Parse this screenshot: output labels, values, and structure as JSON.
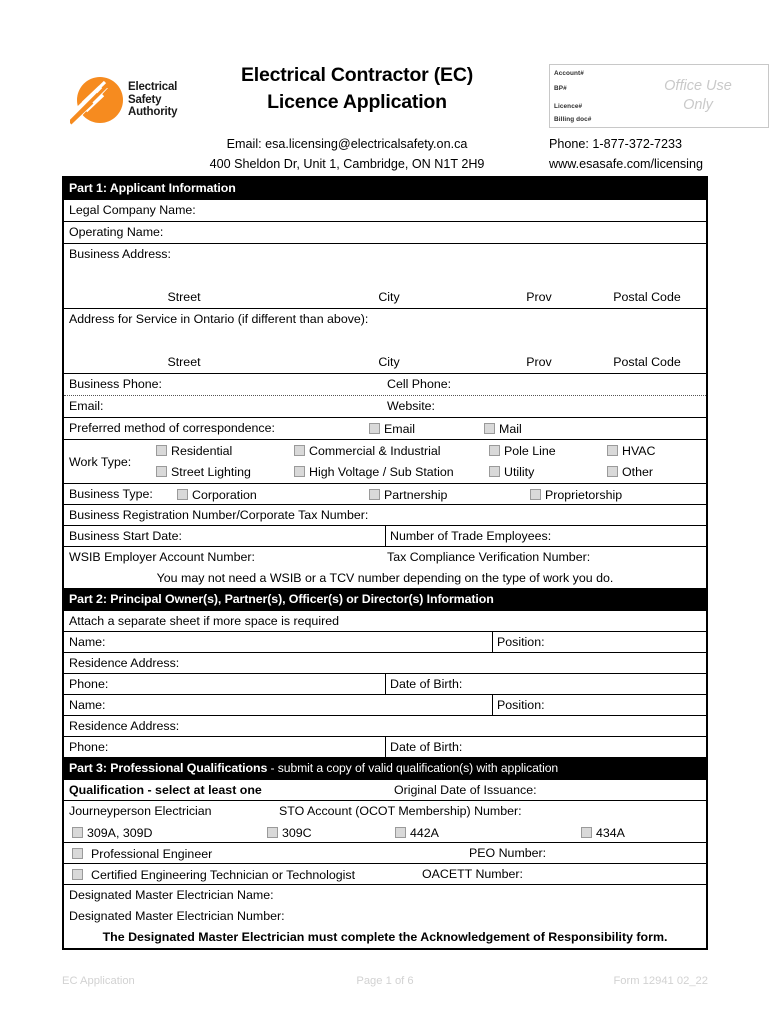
{
  "header": {
    "logo_words": [
      "Electrical",
      "Safety",
      "Authority"
    ],
    "logo_color": "#F68B1F",
    "title_line1": "Electrical Contractor (EC)",
    "title_line2": "Licence Application",
    "email_line": "Email: esa.licensing@electricalsafety.on.ca",
    "address_line": "400 Sheldon Dr, Unit 1, Cambridge, ON N1T 2H9",
    "phone_line": "Phone: 1-877-372-7233",
    "website_line": "www.esasafe.com/licensing",
    "office_use": {
      "watermark_line1": "Office Use",
      "watermark_line2": "Only",
      "fields": [
        "Account#",
        "BP#",
        "Licence#",
        "Billing doc#"
      ]
    }
  },
  "part1": {
    "header": "Part 1: Applicant Information",
    "legal_company_name": "Legal Company Name:",
    "operating_name": "Operating Name:",
    "business_address": "Business Address:",
    "service_address": "Address for Service in Ontario (if different than above):",
    "address_columns": [
      "Street",
      "City",
      "Prov",
      "Postal Code"
    ],
    "business_phone": "Business Phone:",
    "cell_phone": "Cell Phone:",
    "email": "Email:",
    "website": "Website:",
    "preferred_method": "Preferred method of correspondence:",
    "preferred_options": [
      "Email",
      "Mail"
    ],
    "work_type_label": "Work Type:",
    "work_type_options_row1": [
      "Residential",
      "Commercial & Industrial",
      "Pole Line",
      "HVAC"
    ],
    "work_type_options_row2": [
      "Street Lighting",
      "High Voltage / Sub Station",
      "Utility",
      "Other"
    ],
    "business_type_label": "Business Type:",
    "business_type_options": [
      "Corporation",
      "Partnership",
      "Proprietorship"
    ],
    "business_registration": "Business Registration Number/Corporate Tax Number:",
    "business_start_date": "Business Start Date:",
    "trade_employees": "Number of Trade Employees:",
    "wsib": "WSIB Employer Account Number:",
    "tcv": "Tax Compliance Verification Number:",
    "wsib_note": "You may not need a WSIB or a TCV number depending on the type of work you do."
  },
  "part2": {
    "header": "Part 2: Principal Owner(s), Partner(s), Officer(s) or Director(s) Information",
    "attach_note": "Attach a separate sheet if more space is required",
    "name": "Name:",
    "position": "Position:",
    "residence_address": "Residence Address:",
    "phone": "Phone:",
    "date_of_birth": "Date of Birth:"
  },
  "part3": {
    "header_bold": "Part 3: Professional Qualifications",
    "header_rest": " - submit a copy of valid qualification(s) with application",
    "qualification_label": "Qualification - select at least one",
    "original_date": "Original Date of Issuance:",
    "journeyperson": "Journeyperson Electrician",
    "sto_account": "STO Account (OCOT Membership) Number:",
    "trade_codes": [
      "309A, 309D",
      "309C",
      "442A",
      "434A"
    ],
    "professional_engineer": "Professional Engineer",
    "peo_number": "PEO Number:",
    "certified_tech": "Certified Engineering Technician or Technologist",
    "oacett_number": "OACETT Number:",
    "dme_name": "Designated Master Electrician Name:",
    "dme_number": "Designated Master Electrician Number:",
    "dme_note": "The Designated Master Electrician must complete the Acknowledgement of Responsibility form."
  },
  "footer": {
    "left": "EC Application",
    "center": "Page 1 of 6",
    "right": "Form 12941 02_22"
  }
}
